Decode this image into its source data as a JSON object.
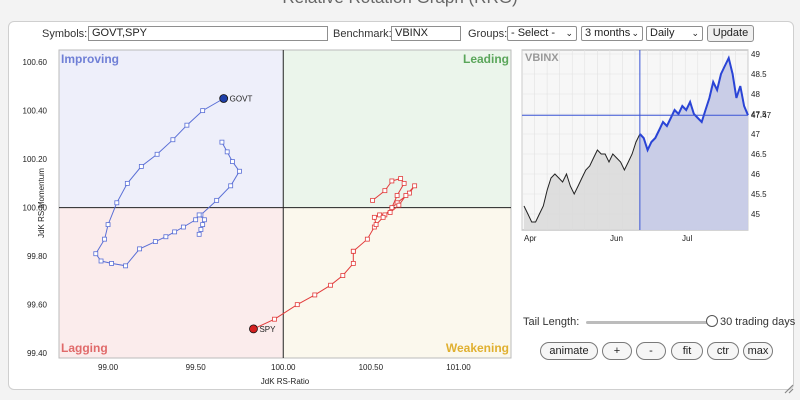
{
  "page": {
    "title": "Relative Rotation Graph (RRG)"
  },
  "form": {
    "symbols_label": "Symbols:",
    "symbols_value": "GOVT,SPY",
    "benchmark_label": "Benchmark:",
    "benchmark_value": "VBINX",
    "groups_label": "Groups:",
    "groups_value": "- Select -",
    "period_value": "3 months",
    "frequency_value": "Daily",
    "update_label": "Update"
  },
  "rrg": {
    "quadrants": {
      "improving": "Improving",
      "leading": "Leading",
      "lagging": "Lagging",
      "weakening": "Weakening"
    },
    "colors": {
      "improving": "#eeeffa",
      "leading": "#ebf5eb",
      "lagging": "#fbecec",
      "weakening": "#fbf8ed",
      "govt": "#5a6fd6",
      "spy": "#e23c3c"
    },
    "xlabel": "JdK RS-Ratio",
    "ylabel": "JdK RS-Momentum",
    "xlim": [
      98.72,
      101.3
    ],
    "ylim": [
      99.38,
      100.65
    ],
    "x_ticks": [
      "99.00",
      "99.50",
      "100.00",
      "100.50",
      "101.00"
    ],
    "y_ticks": [
      "100.60",
      "100.40",
      "100.20",
      "100.00",
      "99.80",
      "99.60",
      "99.40"
    ],
    "series": [
      {
        "name": "GOVT",
        "points": [
          [
            99.52,
            99.89
          ],
          [
            99.53,
            99.91
          ],
          [
            99.54,
            99.93
          ],
          [
            99.55,
            99.95
          ],
          [
            99.52,
            99.97
          ],
          [
            99.5,
            99.95
          ],
          [
            99.43,
            99.92
          ],
          [
            99.38,
            99.9
          ],
          [
            99.33,
            99.88
          ],
          [
            99.27,
            99.86
          ],
          [
            99.18,
            99.83
          ],
          [
            99.1,
            99.76
          ],
          [
            99.02,
            99.77
          ],
          [
            98.96,
            99.78
          ],
          [
            98.93,
            99.81
          ],
          [
            98.98,
            99.87
          ],
          [
            99.0,
            99.93
          ],
          [
            99.05,
            100.02
          ],
          [
            99.11,
            100.1
          ],
          [
            99.19,
            100.17
          ],
          [
            99.28,
            100.22
          ],
          [
            99.37,
            100.28
          ],
          [
            99.45,
            100.34
          ],
          [
            99.54,
            100.4
          ],
          [
            99.66,
            100.45
          ]
        ],
        "hook": [
          [
            99.53,
            99.97
          ],
          [
            99.62,
            100.03
          ],
          [
            99.7,
            100.09
          ],
          [
            99.75,
            100.15
          ],
          [
            99.71,
            100.19
          ],
          [
            99.68,
            100.23
          ],
          [
            99.65,
            100.27
          ]
        ]
      },
      {
        "name": "SPY",
        "points": [
          [
            100.4,
            99.82
          ],
          [
            100.48,
            99.87
          ],
          [
            100.52,
            99.92
          ],
          [
            100.58,
            99.97
          ],
          [
            100.65,
            100.02
          ],
          [
            100.72,
            100.06
          ],
          [
            100.75,
            100.09
          ],
          [
            100.7,
            100.05
          ],
          [
            100.66,
            100.01
          ],
          [
            100.61,
            99.98
          ],
          [
            100.55,
            99.97
          ],
          [
            100.52,
            99.96
          ],
          [
            100.53,
            99.93
          ],
          [
            100.57,
            99.96
          ],
          [
            100.62,
            100.0
          ],
          [
            100.65,
            100.05
          ],
          [
            100.69,
            100.1
          ],
          [
            100.67,
            100.12
          ],
          [
            100.62,
            100.11
          ],
          [
            100.58,
            100.07
          ],
          [
            100.51,
            100.03
          ]
        ],
        "tail_start": [
          [
            99.83,
            99.5
          ],
          [
            99.95,
            99.54
          ],
          [
            100.08,
            99.6
          ],
          [
            100.18,
            99.64
          ],
          [
            100.27,
            99.68
          ],
          [
            100.34,
            99.72
          ],
          [
            100.4,
            99.77
          ],
          [
            100.4,
            99.82
          ]
        ]
      }
    ]
  },
  "side_chart": {
    "title": "VBINX",
    "y_ticks": [
      "49",
      "48.5",
      "48",
      "47.5",
      "47",
      "46.5",
      "46",
      "45.5",
      "45"
    ],
    "current_value": "47.47",
    "x_labels": [
      "Apr",
      "Jun",
      "Jul"
    ],
    "ylim": [
      44.6,
      49.1
    ],
    "values": [
      45.2,
      45.0,
      44.8,
      44.8,
      45.0,
      45.2,
      45.6,
      45.9,
      46.0,
      45.9,
      45.8,
      46.0,
      45.7,
      45.5,
      45.7,
      45.9,
      46.1,
      46.2,
      46.4,
      46.6,
      46.5,
      46.5,
      46.3,
      46.5,
      46.4,
      46.3,
      46.1,
      46.3,
      46.5,
      46.8,
      47.0,
      46.9,
      46.6,
      46.8,
      46.9,
      47.1,
      47.3,
      47.2,
      47.4,
      47.6,
      47.5,
      47.7,
      47.6,
      47.8,
      47.5,
      47.4,
      47.3,
      47.6,
      47.9,
      48.3,
      48.1,
      48.5,
      48.7,
      48.9,
      48.5,
      47.9,
      48.2,
      47.7,
      47.47
    ]
  },
  "controls": {
    "tail_label": "Tail Length:",
    "tail_value": "30 trading days",
    "animate": "animate",
    "plus": "+",
    "minus": "-",
    "fit": "fit",
    "ctr": "ctr",
    "max": "max"
  }
}
